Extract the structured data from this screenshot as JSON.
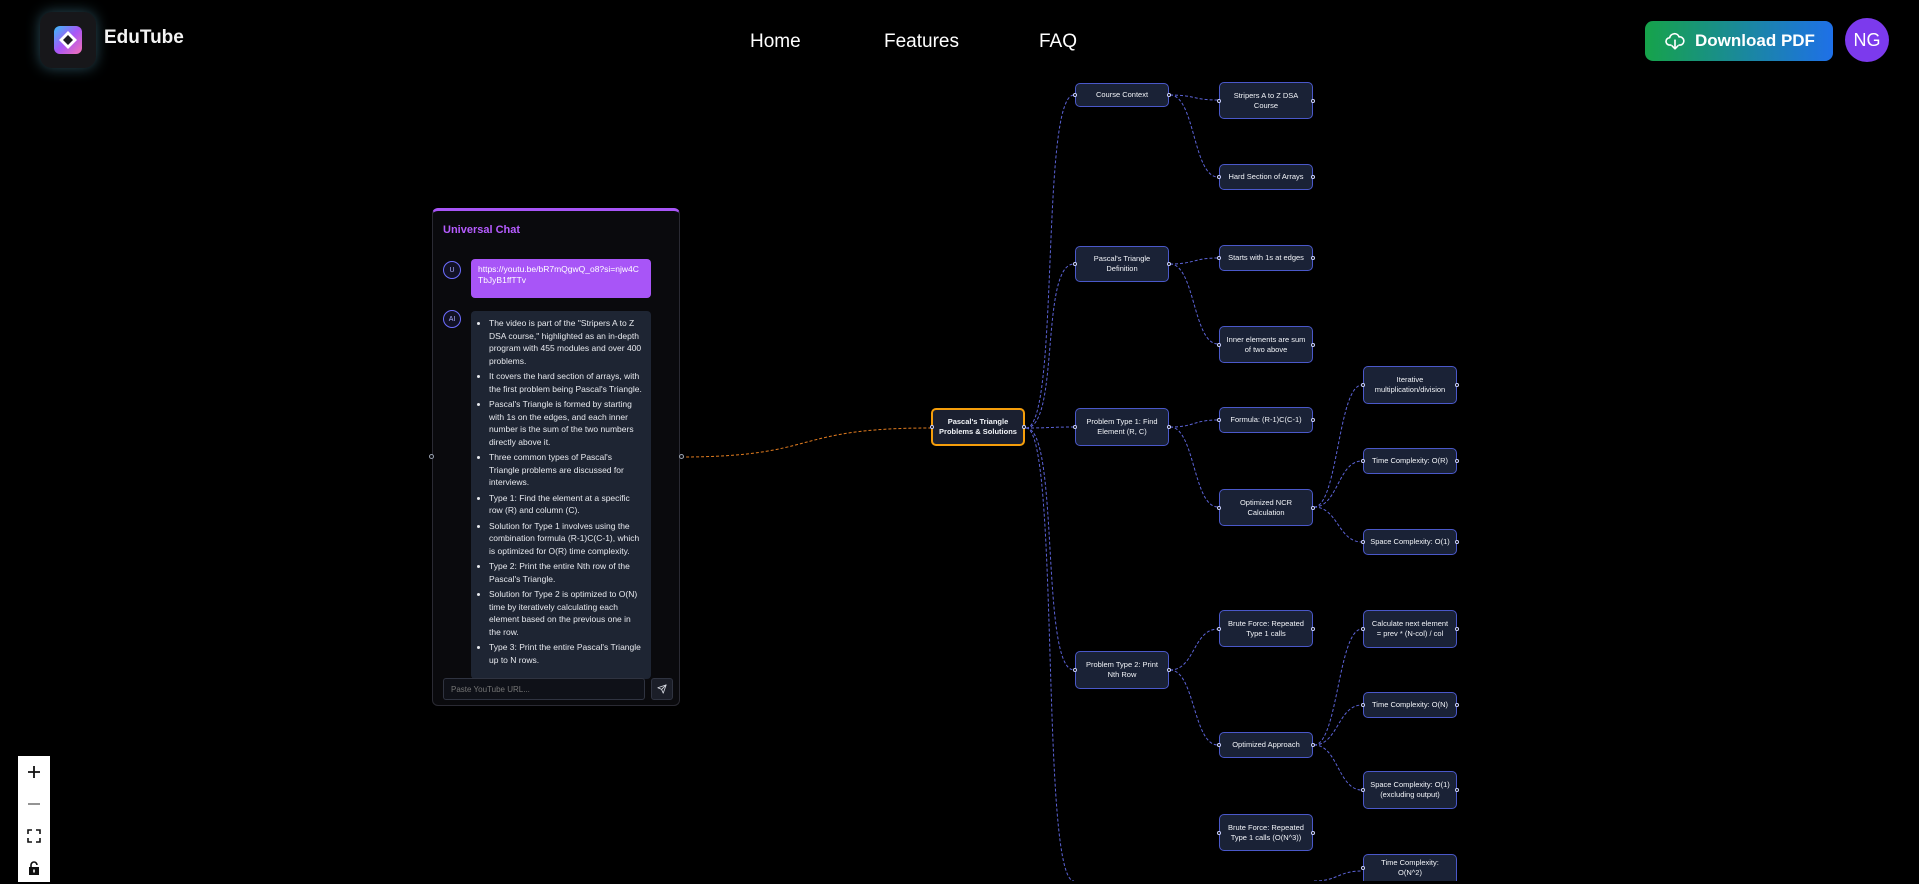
{
  "header": {
    "brand": "EduTube",
    "nav": [
      "Home",
      "Features",
      "FAQ"
    ],
    "download_label": "Download PDF",
    "avatar_initials": "NG"
  },
  "chat": {
    "title": "Universal Chat",
    "user_badge": "U",
    "ai_badge": "AI",
    "user_message": "https://youtu.be/bR7mQgwQ_o8?si=njw4CTbJyB1ffTTv",
    "ai_points": [
      "The video is part of the \"Stripers A to Z DSA course,\" highlighted as an in-depth program with 455 modules and over 400 problems.",
      "It covers the hard section of arrays, with the first problem being Pascal's Triangle.",
      "Pascal's Triangle is formed by starting with 1s on the edges, and each inner number is the sum of the two numbers directly above it.",
      "Three common types of Pascal's Triangle problems are discussed for interviews.",
      "Type 1: Find the element at a specific row (R) and column (C).",
      "Solution for Type 1 involves using the combination formula (R-1)C(C-1), which is optimized for O(R) time complexity.",
      "Type 2: Print the entire Nth row of the Pascal's Triangle.",
      "Solution for Type 2 is optimized to O(N) time by iteratively calculating each element based on the previous one in the row.",
      "Type 3: Print the entire Pascal's Triangle up to N rows."
    ],
    "input_placeholder": "Paste YouTube URL..."
  },
  "mindmap": {
    "root": "Pascal's Triangle Problems & Solutions",
    "level1": [
      "Course Context",
      "Pascal's Triangle Definition",
      "Problem Type 1: Find Element (R, C)",
      "Problem Type 2: Print Nth Row"
    ],
    "level2": [
      "Stripers A to Z DSA Course",
      "Hard Section of Arrays",
      "Starts with 1s at edges",
      "Inner elements are sum of two above",
      "Formula: (R-1)C(C-1)",
      "Optimized NCR Calculation",
      "Brute Force: Repeated Type 1 calls",
      "Optimized Approach",
      "Brute Force: Repeated Type 1 calls (O(N^3))"
    ],
    "level3": [
      "Iterative multiplication/division",
      "Time Complexity: O(R)",
      "Space Complexity: O(1)",
      "Calculate next element = prev * (N-col) / col",
      "Time Complexity: O(N)",
      "Space Complexity: O(1) (excluding output)",
      "Time Complexity: O(N^2)"
    ]
  },
  "controls": [
    "zoom-in",
    "zoom-out",
    "fit-view",
    "lock"
  ],
  "colors": {
    "accent_purple": "#a855f7",
    "root_border": "#f59e0b",
    "node_border": "#4a58c9",
    "download_gradient_start": "#16a34a",
    "download_gradient_end": "#1e70e8"
  }
}
